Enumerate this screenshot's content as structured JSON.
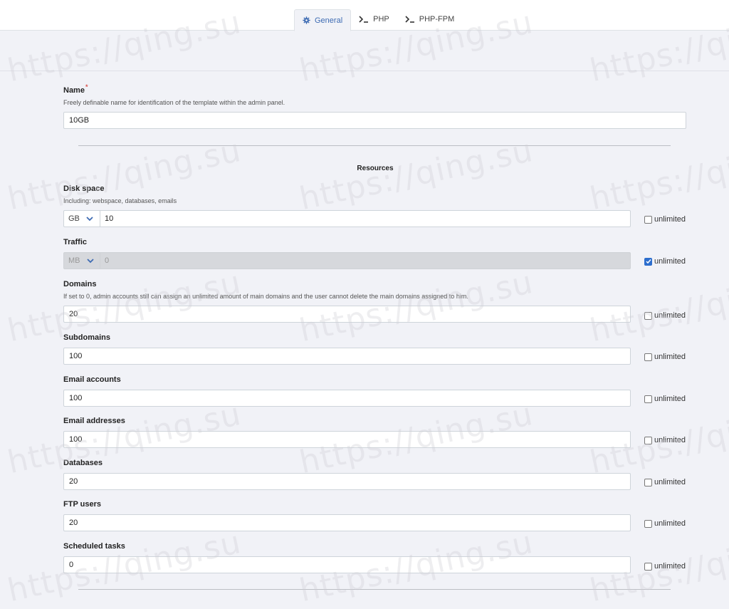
{
  "tabs": [
    {
      "label": "General",
      "icon": "gear-icon"
    },
    {
      "label": "PHP",
      "icon": "terminal-icon"
    },
    {
      "label": "PHP-FPM",
      "icon": "terminal-icon"
    }
  ],
  "name_field": {
    "label": "Name",
    "required_mark": "*",
    "help": "Freely definable name for identification of the template within the admin panel.",
    "value": "10GB"
  },
  "section_title": "Resources",
  "unlimited_label": "unlimited",
  "disk": {
    "label": "Disk space",
    "help": "Including: webspace, databases, emails",
    "unit": "GB",
    "value": "10",
    "unlimited": false
  },
  "traffic": {
    "label": "Traffic",
    "unit": "MB",
    "value": "0",
    "unlimited": true
  },
  "domains": {
    "label": "Domains",
    "help": "If set to 0, admin accounts still can assign an unlimited amount of main domains and the user cannot delete the main domains assigned to him.",
    "value": "20",
    "unlimited": false
  },
  "subdomains": {
    "label": "Subdomains",
    "value": "100",
    "unlimited": false
  },
  "email_accounts": {
    "label": "Email accounts",
    "value": "100",
    "unlimited": false
  },
  "email_addresses": {
    "label": "Email addresses",
    "value": "100",
    "unlimited": false
  },
  "databases": {
    "label": "Databases",
    "value": "20",
    "unlimited": false
  },
  "ftp_users": {
    "label": "FTP users",
    "value": "20",
    "unlimited": false
  },
  "scheduled_tasks": {
    "label": "Scheduled tasks",
    "value": "0",
    "unlimited": false
  },
  "watermark": "https://qing.su",
  "colors": {
    "accent": "#3d6bb3",
    "checkbox_on": "#2d6ecd",
    "required": "#d9534f",
    "background": "#f1f2f7"
  }
}
